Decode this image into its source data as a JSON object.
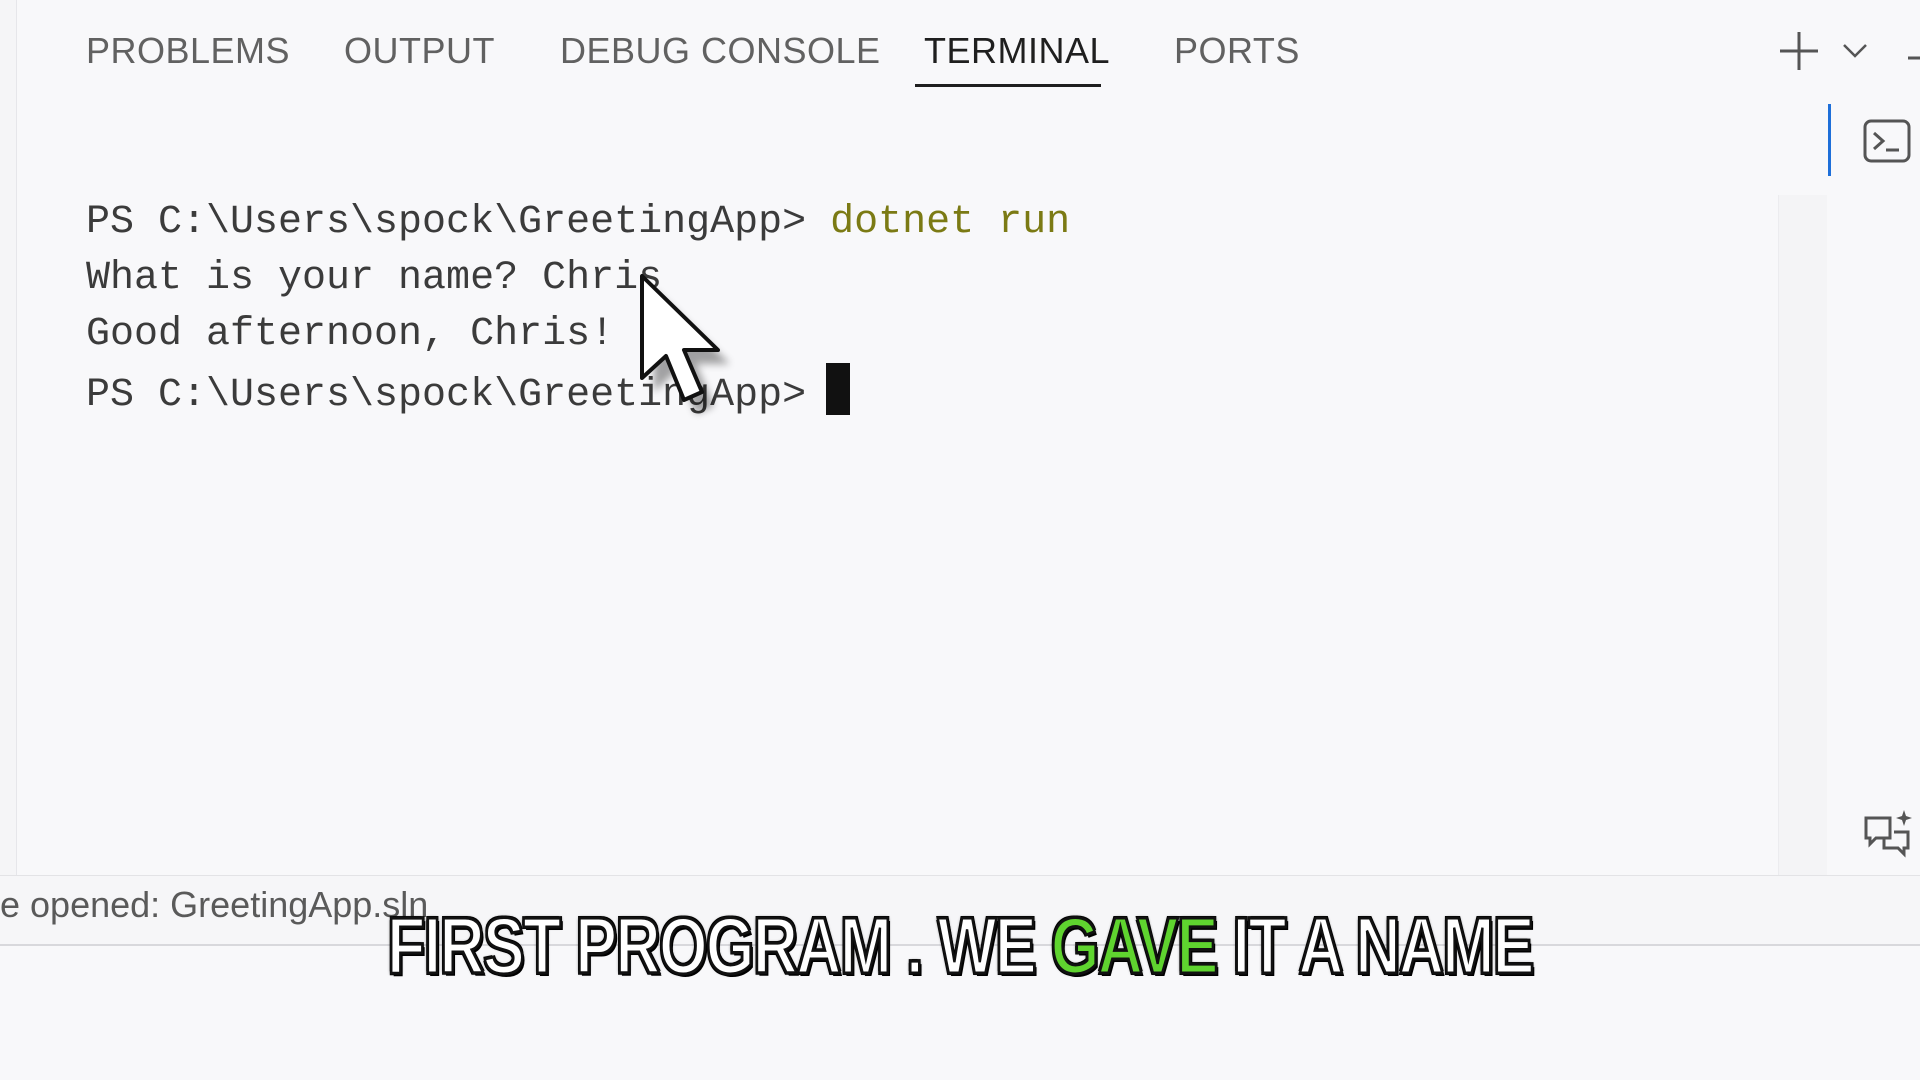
{
  "panel": {
    "tabs": [
      {
        "label": "PROBLEMS"
      },
      {
        "label": "OUTPUT"
      },
      {
        "label": "DEBUG CONSOLE"
      },
      {
        "label": "TERMINAL",
        "active": true
      },
      {
        "label": "PORTS"
      }
    ],
    "actions": {
      "add_icon": "plus-icon",
      "dropdown_icon": "chevron-down-icon"
    }
  },
  "terminal": {
    "lines": [
      {
        "prompt": "PS C:\\Users\\spock\\GreetingApp>",
        "command": "dotnet run"
      },
      {
        "text": "What is your name? Chris"
      },
      {
        "text": "Good afternoon, Chris!"
      },
      {
        "prompt": "PS C:\\Users\\spock\\GreetingApp>",
        "command": ""
      }
    ]
  },
  "sidebar_icons": [
    "terminal-icon",
    "chat-sparkle-icon"
  ],
  "status": {
    "text": "e opened: GreetingApp.sln"
  },
  "caption": {
    "before": "FIRST PROGRAM . WE ",
    "highlight": "GAVE",
    "after": " IT A NAME"
  },
  "colors": {
    "command": "#7b7a14",
    "accent": "#1e6fd9",
    "caption_highlight": "#5fd42f"
  }
}
